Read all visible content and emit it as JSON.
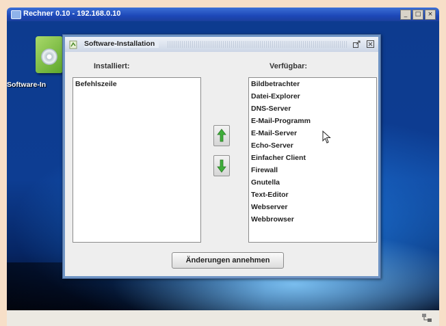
{
  "outer_window": {
    "title": "Rechner 0.10 - 192.168.0.10",
    "controls": [
      "_",
      "□",
      "×"
    ]
  },
  "desktop": {
    "icon_label": "Software-In"
  },
  "dialog": {
    "title": "Software-Installation",
    "installed_header": "Installiert:",
    "available_header": "Verfügbar:",
    "installed_items": [
      "Befehlszeile"
    ],
    "available_items": [
      "Bildbetrachter",
      "Datei-Explorer",
      "DNS-Server",
      "E-Mail-Programm",
      "E-Mail-Server",
      "Echo-Server",
      "Einfacher Client",
      "Firewall",
      "Gnutella",
      "Text-Editor",
      "Webserver",
      "Webbrowser"
    ],
    "apply_label": "Änderungen annehmen",
    "detach_icon": "detach-icon",
    "close_icon": "close-icon"
  },
  "colors": {
    "arrow_green": "#3fae3a",
    "desktop_blue": "#0d3b8f",
    "dialog_frame": "#6f94c4"
  }
}
